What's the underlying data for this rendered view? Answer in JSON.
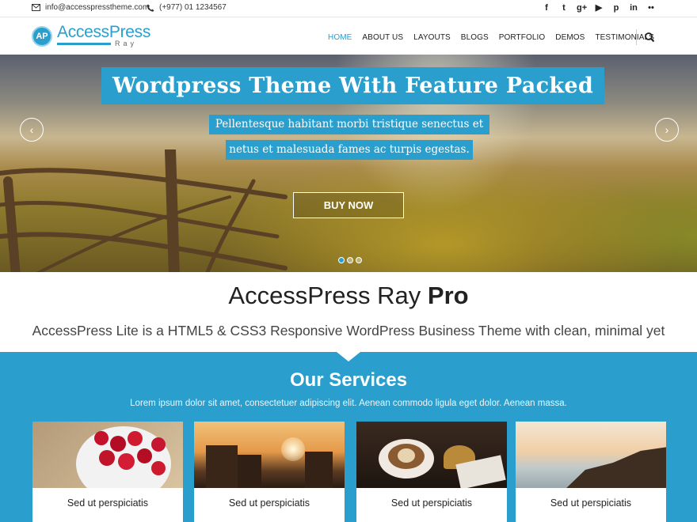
{
  "topbar": {
    "email": "info@accesspresstheme.com",
    "phone": "(+977) 01 1234567",
    "social": [
      "facebook-icon",
      "twitter-icon",
      "google-plus-icon",
      "youtube-icon",
      "pinterest-icon",
      "linkedin-icon",
      "flickr-icon"
    ],
    "social_glyphs": [
      "f",
      "t",
      "g+",
      "▶",
      "p",
      "in",
      "••"
    ]
  },
  "header": {
    "logo_badge": "AP",
    "logo_name": "AccessPress",
    "logo_sub": "Ray",
    "nav": [
      "HOME",
      "ABOUT US",
      "LAYOUTS",
      "BLOGS",
      "PORTFOLIO",
      "DEMOS",
      "TESTIMONIALS"
    ],
    "active_nav": "HOME"
  },
  "hero": {
    "title": "Wordpress Theme With Feature Packed",
    "subtitle_line1": "Pellentesque habitant morbi tristique senectus et",
    "subtitle_line2": "netus et malesuada fames ac turpis egestas.",
    "button": "BUY NOW",
    "prev_glyph": "‹",
    "next_glyph": "›",
    "slide_count": 3,
    "active_slide": 1
  },
  "intro": {
    "title_light": "AccessPress Ray",
    "title_bold": "Pro",
    "text": "AccessPress Lite is a HTML5 & CSS3 Responsive WordPress Business Theme with clean, minimal yet"
  },
  "services": {
    "title_bold": "Our",
    "title_light": "Services",
    "text": "Lorem ipsum dolor sit amet, consectetuer adipiscing elit. Aenean commodo ligula eget dolor. Aenean massa.",
    "cards": [
      {
        "label": "Sed ut perspiciatis"
      },
      {
        "label": "Sed ut perspiciatis"
      },
      {
        "label": "Sed ut perspiciatis"
      },
      {
        "label": "Sed ut perspiciatis"
      }
    ]
  },
  "colors": {
    "accent": "#2a9fcd"
  }
}
